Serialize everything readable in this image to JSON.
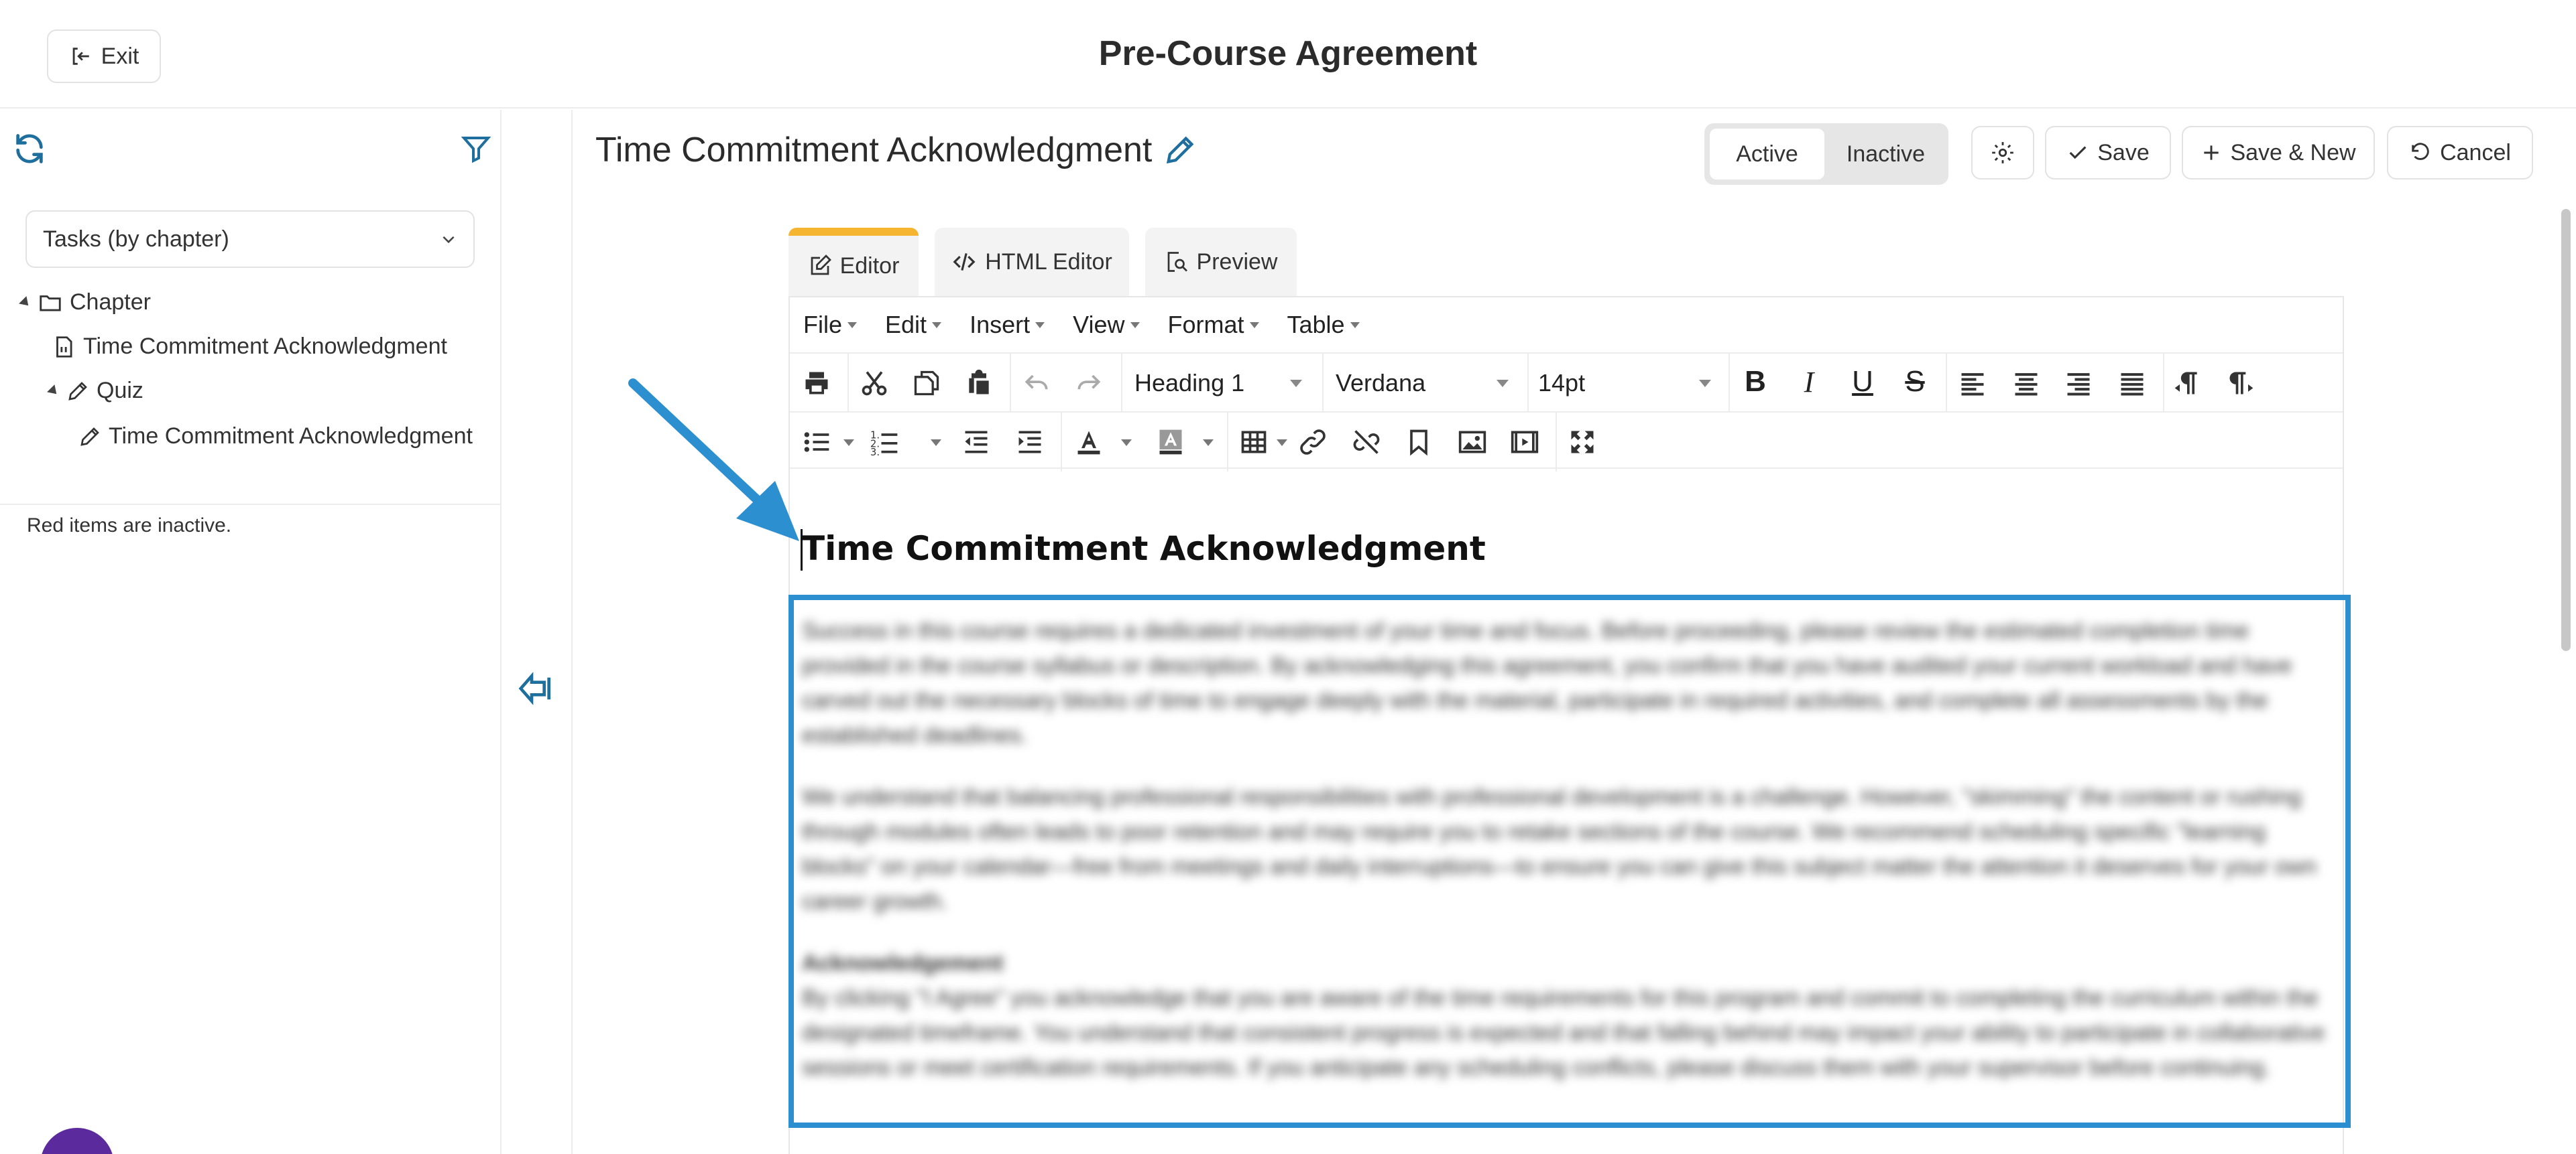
{
  "header": {
    "exit_label": "Exit",
    "page_title": "Pre-Course Agreement"
  },
  "sidebar": {
    "view_select": "Tasks (by chapter)",
    "tree": [
      {
        "label": "Chapter",
        "icon": "folder-icon"
      },
      {
        "label": "Time Commitment Acknowledgment",
        "icon": "document-icon"
      },
      {
        "label": "Quiz",
        "icon": "pencil-icon"
      },
      {
        "label": "Time Commitment Acknowledgment",
        "icon": "pencil-icon"
      }
    ],
    "note": "Red items are inactive."
  },
  "main": {
    "title": "Time Commitment Acknowledgment",
    "status_toggle": [
      "Active",
      "Inactive"
    ],
    "status_selected": "Active",
    "buttons": {
      "save": "Save",
      "save_new": "Save & New",
      "cancel": "Cancel"
    }
  },
  "editor": {
    "tabs": [
      "Editor",
      "HTML Editor",
      "Preview"
    ],
    "selected_tab": "Editor",
    "menus": [
      "File",
      "Edit",
      "Insert",
      "View",
      "Format",
      "Table"
    ],
    "block_format": "Heading 1",
    "font_family": "Verdana",
    "font_size": "14pt",
    "content_heading": "Time Commitment Acknowledgment",
    "paragraphs": [
      "Success in this course requires a dedicated investment of your time and focus. Before proceeding, please review the estimated completion time provided in the course syllabus or description. By acknowledging this agreement, you confirm that you have audited your current workload and have carved out the necessary blocks of time to engage deeply with the material, participate in required activities, and complete all assessments by the established deadlines.",
      "We understand that balancing professional responsibilities with professional development is a challenge. However, \"skimming\" the content or rushing through modules often leads to poor retention and may require you to retake sections of the course. We recommend scheduling specific \"learning blocks\" on your calendar—free from meetings and daily interruptions—to ensure you can give this subject matter the attention it deserves for your own career growth.",
      "Acknowledgement",
      "By clicking \"I Agree\" you acknowledge that you are aware of the time requirements for this program and commit to completing the curriculum within the designated timeframe. You understand that consistent progress is expected and that falling behind may impact your ability to participate in collaborative sessions or meet certification requirements. If you anticipate any scheduling conflicts, please discuss them with your supervisor before continuing."
    ]
  },
  "colors": {
    "accent_blue": "#2b8fd0",
    "tab_accent": "#f6b531",
    "icon_blue": "#1f6f9e"
  }
}
